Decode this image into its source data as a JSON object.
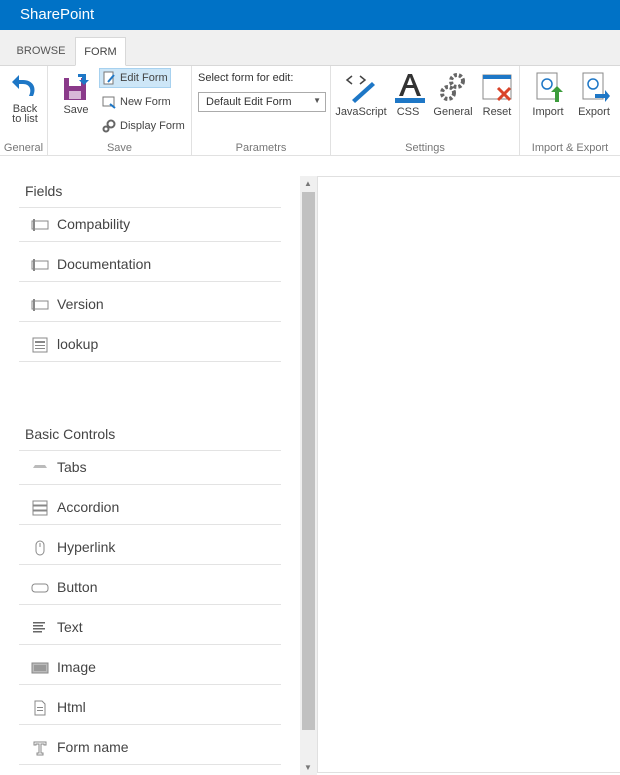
{
  "suite": {
    "brand": "SharePoint"
  },
  "tabs": {
    "browse": "BROWSE",
    "form": "FORM"
  },
  "ribbon": {
    "general": {
      "label": "General",
      "back": "Back to list"
    },
    "save": {
      "label": "Save",
      "save_btn": "Save",
      "edit_form": "Edit Form",
      "new_form": "New Form",
      "display_form": "Display Form"
    },
    "parametrs": {
      "label": "Parametrs",
      "select_label": "Select form for edit:",
      "select_value": "Default Edit Form"
    },
    "settings": {
      "label": "Settings",
      "javascript": "JavaScript",
      "css": "CSS",
      "general": "General",
      "reset": "Reset"
    },
    "import_export": {
      "label": "Import & Export",
      "import": "Import",
      "export": "Export"
    }
  },
  "fields": {
    "title": "Fields",
    "items": [
      "Compability",
      "Documentation",
      "Version",
      "lookup"
    ]
  },
  "basic_controls": {
    "title": "Basic Controls",
    "items": [
      "Tabs",
      "Accordion",
      "Hyperlink",
      "Button",
      "Text",
      "Image",
      "Html",
      "Form name"
    ]
  },
  "colors": {
    "brand": "#0072c6",
    "selected": "#cde6f7",
    "icon_blue": "#1e77c6"
  }
}
